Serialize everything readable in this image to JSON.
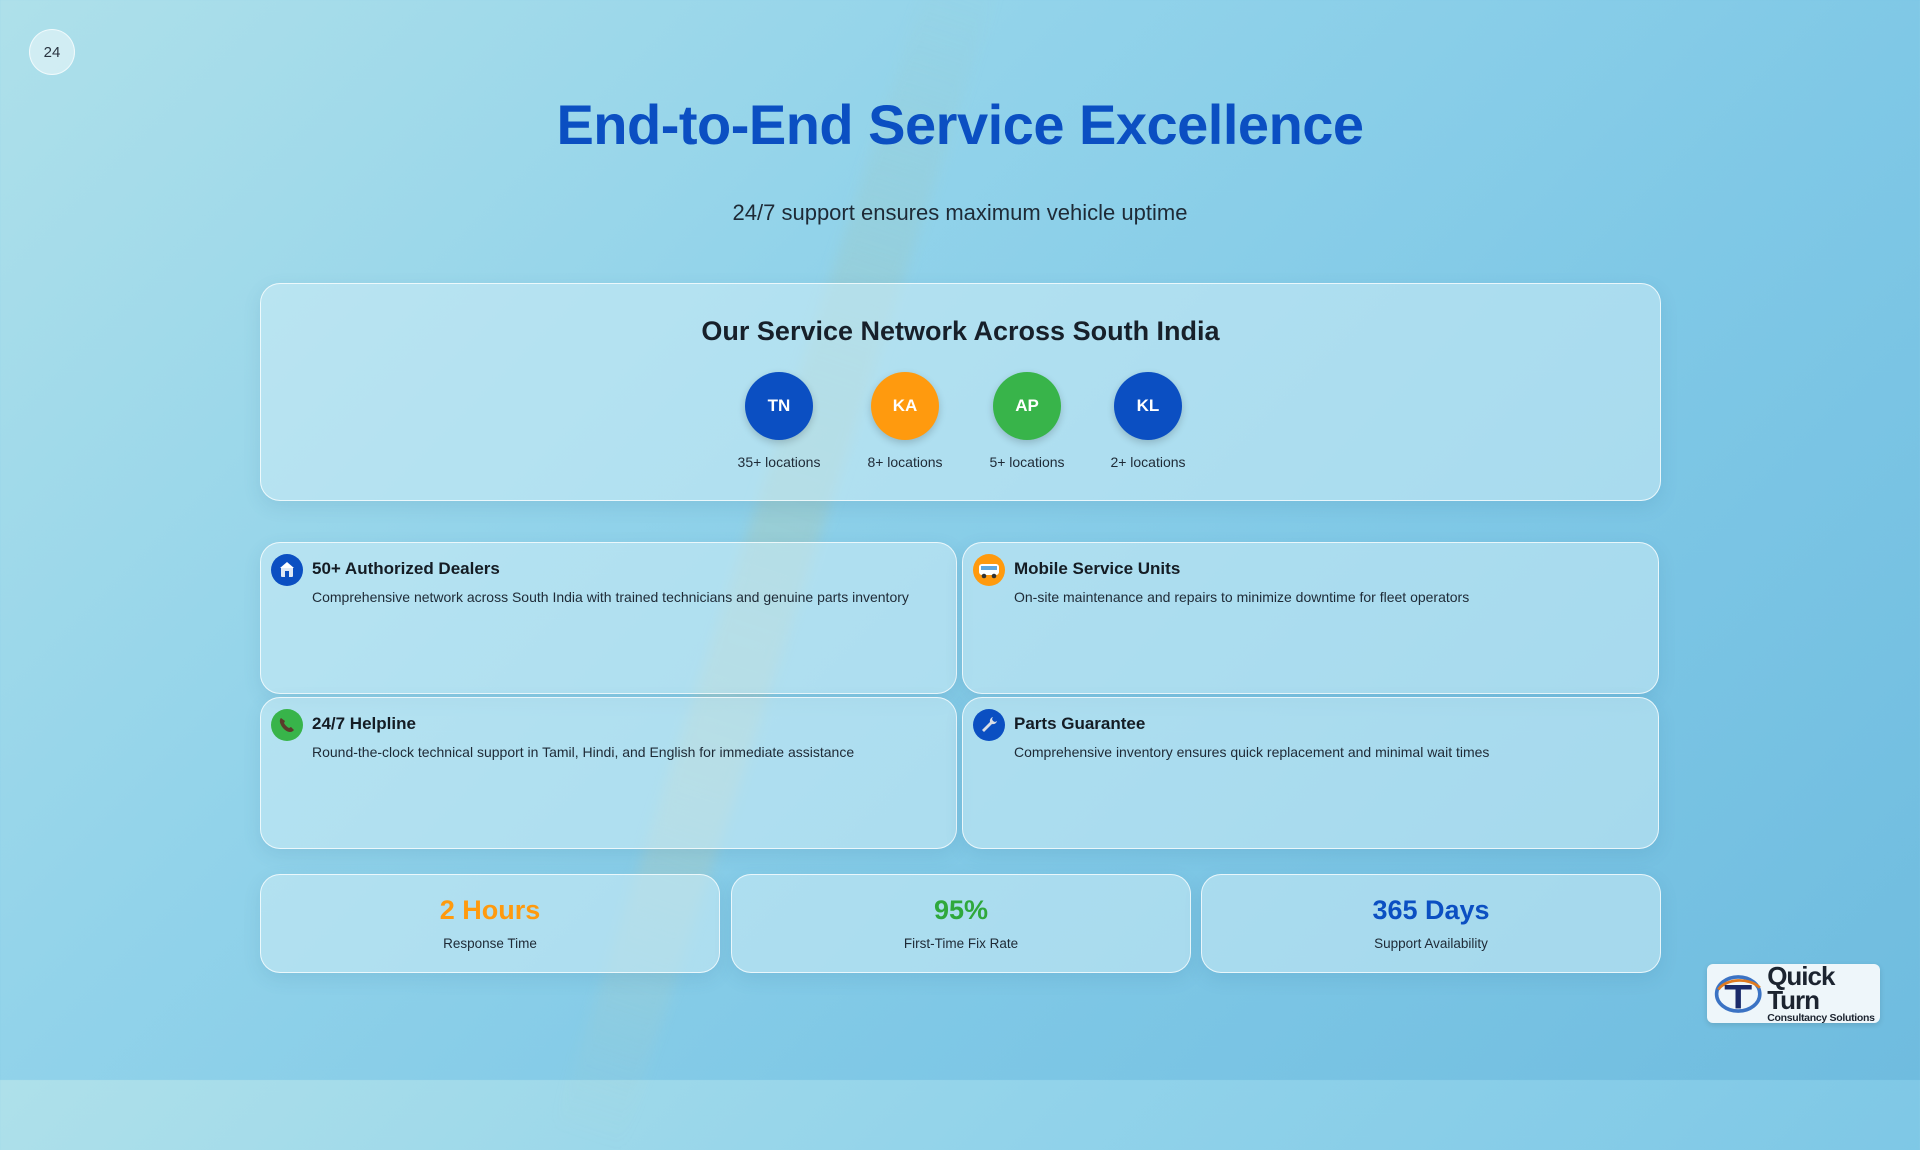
{
  "slide": {
    "page_number": "24"
  },
  "header": {
    "title": "End-to-End Service Excellence",
    "subtitle": "24/7 support ensures maximum vehicle uptime"
  },
  "network": {
    "title": "Our Service Network Across South India",
    "states": [
      {
        "code": "TN",
        "locations": "35+ locations",
        "color": "#0b4fc2"
      },
      {
        "code": "KA",
        "locations": "8+ locations",
        "color": "#ff9a0e"
      },
      {
        "code": "AP",
        "locations": "5+ locations",
        "color": "#38b44a"
      },
      {
        "code": "KL",
        "locations": "2+ locations",
        "color": "#0b4fc2"
      }
    ]
  },
  "features": [
    {
      "title": "50+ Authorized Dealers",
      "description": "Comprehensive network across South India with trained technicians and genuine parts inventory",
      "icon": "dealer-icon",
      "color": "#0b4fc2"
    },
    {
      "title": "Mobile Service Units",
      "description": "On-site maintenance and repairs to minimize downtime for fleet operators",
      "icon": "bus-icon",
      "color": "#ff9a0e"
    },
    {
      "title": "24/7 Helpline",
      "description": "Round-the-clock technical support in Tamil, Hindi, and English for immediate assistance",
      "icon": "phone-icon",
      "color": "#38b44a"
    },
    {
      "title": "Parts Guarantee",
      "description": "Comprehensive inventory ensures quick replacement and minimal wait times",
      "icon": "wrench-icon",
      "color": "#0b4fc2"
    }
  ],
  "stats": [
    {
      "value": "2 Hours",
      "label": "Response Time",
      "color": "#ff9a0e"
    },
    {
      "value": "95%",
      "label": "First-Time Fix Rate",
      "color": "#2fa83c"
    },
    {
      "value": "365 Days",
      "label": "Support Availability",
      "color": "#0b4fc2"
    }
  ],
  "logo": {
    "line1": "Quick Turn",
    "line2": "Consultancy Solutions"
  }
}
